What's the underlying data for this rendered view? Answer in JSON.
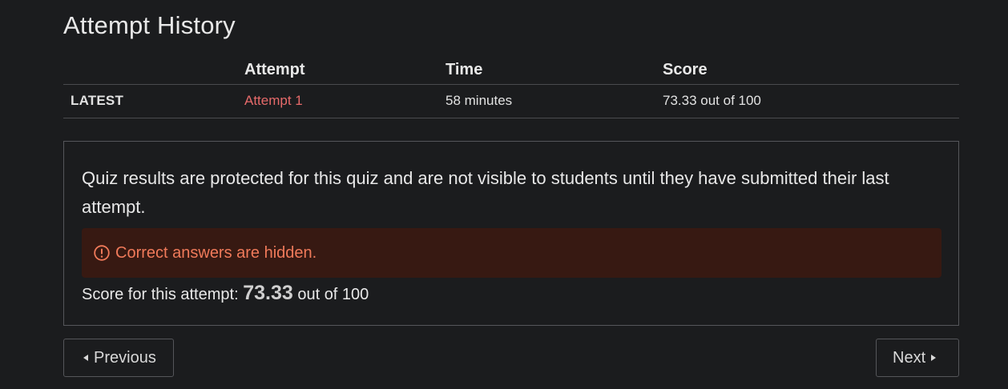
{
  "page": {
    "title": "Attempt History"
  },
  "history": {
    "columns": [
      "",
      "Attempt",
      "Time",
      "Score"
    ],
    "rows": [
      {
        "label": "LATEST",
        "attempt": "Attempt 1",
        "time": "58 minutes",
        "score": "73.33 out of 100"
      }
    ]
  },
  "results": {
    "notice": "Quiz results are protected for this quiz and are not visible to students until they have submitted their last attempt.",
    "alert_icon": "exclamation-circle-icon",
    "alert_text": "Correct answers are hidden.",
    "score_label": "Score for this attempt:",
    "score_value": "73.33",
    "score_suffix": "out of 100"
  },
  "nav": {
    "previous_label": "Previous",
    "next_label": "Next"
  },
  "colors": {
    "background": "#1b1c1e",
    "link": "#e66a6a",
    "alert_bg": "#371912",
    "alert_text": "#f07a5a"
  }
}
